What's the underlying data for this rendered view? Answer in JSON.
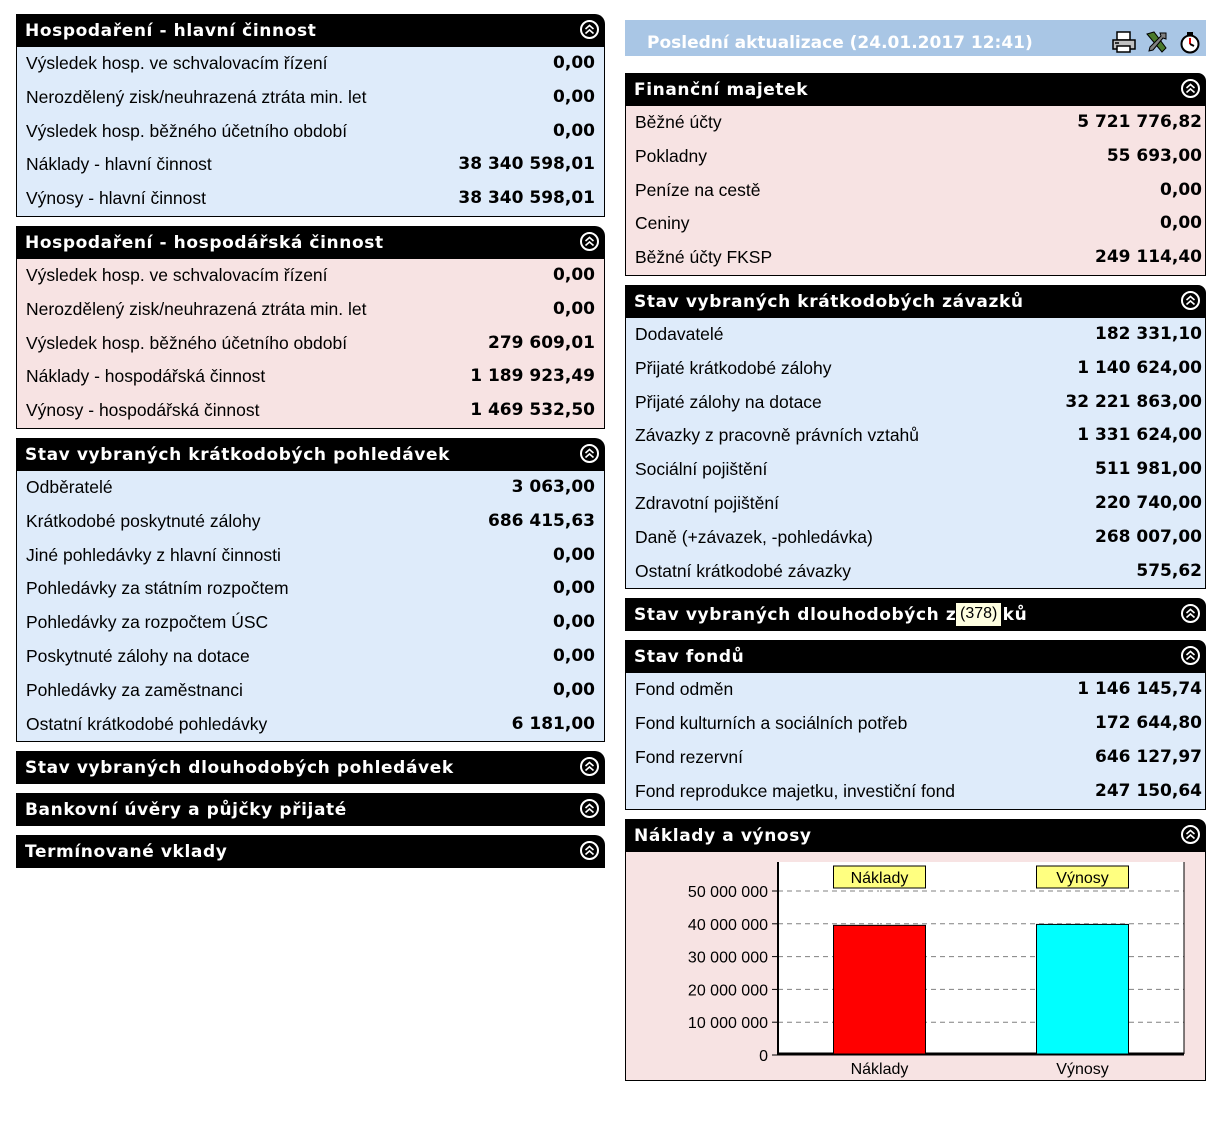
{
  "left_panels": [
    {
      "title": "Hospodaření - hlavní činnost",
      "theme": "blue",
      "rows": [
        {
          "label": "Výsledek hosp. ve schvalovacím řízení",
          "value": "0,00"
        },
        {
          "label": "Nerozdělený zisk/neuhrazená ztráta min. let",
          "value": "0,00"
        },
        {
          "label": "Výsledek hosp. běžného účetního období",
          "value": "0,00"
        },
        {
          "label": "Náklady - hlavní činnost",
          "value": "38 340 598,01"
        },
        {
          "label": "Výnosy - hlavní činnost",
          "value": "38 340 598,01"
        }
      ]
    },
    {
      "title": "Hospodaření - hospodářská činnost",
      "theme": "pink",
      "rows": [
        {
          "label": "Výsledek hosp. ve schvalovacím řízení",
          "value": "0,00"
        },
        {
          "label": "Nerozdělený zisk/neuhrazená ztráta min. let",
          "value": "0,00"
        },
        {
          "label": "Výsledek hosp. běžného účetního období",
          "value": "279 609,01"
        },
        {
          "label": "Náklady - hospodářská činnost",
          "value": "1 189 923,49"
        },
        {
          "label": "Výnosy - hospodářská činnost",
          "value": "1 469 532,50"
        }
      ]
    },
    {
      "title": "Stav vybraných krátkodobých pohledávek",
      "theme": "blue",
      "rows": [
        {
          "label": "Odběratelé",
          "value": "3 063,00"
        },
        {
          "label": "Krátkodobé poskytnuté zálohy",
          "value": "686 415,63"
        },
        {
          "label": "Jiné pohledávky z hlavní činnosti",
          "value": "0,00"
        },
        {
          "label": "Pohledávky za státním rozpočtem",
          "value": "0,00"
        },
        {
          "label": "Pohledávky za rozpočtem ÚSC",
          "value": "0,00"
        },
        {
          "label": "Poskytnuté zálohy na dotace",
          "value": "0,00"
        },
        {
          "label": "Pohledávky za zaměstnanci",
          "value": "0,00"
        },
        {
          "label": "Ostatní krátkodobé pohledávky",
          "value": "6 181,00"
        }
      ]
    },
    {
      "title": "Stav vybraných dlouhodobých pohledávek",
      "theme": "blue",
      "rows": []
    },
    {
      "title": "Bankovní úvěry a půjčky přijaté",
      "theme": "blue",
      "rows": []
    },
    {
      "title": "Termínované vklady",
      "theme": "blue",
      "rows": []
    }
  ],
  "topbar": {
    "title": "Poslední aktualizace (24.01.2017 12:41)",
    "tools": [
      "print-icon",
      "tools-icon",
      "timer-icon"
    ]
  },
  "right_panels": [
    {
      "title": "Finanční majetek",
      "theme": "pink",
      "rows": [
        {
          "label": "Běžné účty",
          "value": "5 721 776,82"
        },
        {
          "label": "Pokladny",
          "value": "55 693,00"
        },
        {
          "label": "Peníze na cestě",
          "value": "0,00"
        },
        {
          "label": "Ceniny",
          "value": "0,00"
        },
        {
          "label": "Běžné účty FKSP",
          "value": "249 114,40"
        }
      ]
    },
    {
      "title": "Stav vybraných krátkodobých závazků",
      "theme": "blue",
      "rows": [
        {
          "label": "Dodavatelé",
          "value": "182 331,10"
        },
        {
          "label": "Přijaté krátkodobé zálohy",
          "value": "1 140 624,00"
        },
        {
          "label": "Přijaté zálohy na dotace",
          "value": "32 221 863,00"
        },
        {
          "label": "Závazky z pracovně právních vztahů",
          "value": "1 331 624,00"
        },
        {
          "label": "Sociální pojištění",
          "value": "511 981,00"
        },
        {
          "label": "Zdravotní pojištění",
          "value": "220 740,00"
        },
        {
          "label": "Daně (+závazek, -pohledávka)",
          "value": "268 007,00"
        },
        {
          "label": "Ostatní krátkodobé závazky",
          "value": "575,62"
        }
      ]
    },
    {
      "title": "Stav vybraných dlouhodobých závazků",
      "theme": "blue",
      "rows": []
    },
    {
      "title": "Stav fondů",
      "theme": "blue",
      "rows": [
        {
          "label": "Fond odměn",
          "value": "1 146 145,74"
        },
        {
          "label": "Fond kulturních a sociálních potřeb",
          "value": "172 644,80"
        },
        {
          "label": "Fond rezervní",
          "value": "646 127,97"
        },
        {
          "label": "Fond reprodukce majetku, investiční fond",
          "value": "247 150,64"
        }
      ]
    }
  ],
  "chart_panel": {
    "title": "Náklady a výnosy"
  },
  "tooltip": "(378)",
  "colors": {
    "header_bg": "#000000",
    "blue_row_bg": "#deebfa",
    "pink_row_bg": "#f7e3e3",
    "topbar_bg": "#a9c6e5"
  },
  "chart_data": {
    "type": "bar",
    "categories": [
      "Náklady",
      "Výnosy"
    ],
    "values": [
      39530521.5,
      39810130.51
    ],
    "bar_colors": [
      "#ff0000",
      "#00ffff"
    ],
    "bar_labels": [
      "Náklady",
      "Výnosy"
    ],
    "ylim": [
      0,
      50000000
    ],
    "yticks": [
      0,
      10000000,
      20000000,
      30000000,
      40000000,
      50000000
    ],
    "ytick_labels": [
      "0",
      "10 000 000",
      "20 000 000",
      "30 000 000",
      "40 000 000",
      "50 000 000"
    ],
    "grid": true
  }
}
